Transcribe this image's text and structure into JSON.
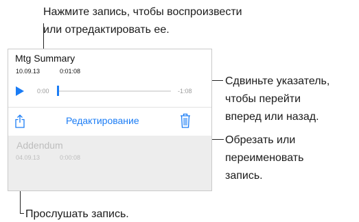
{
  "callouts": {
    "top_line1": "Нажмите запись, чтобы воспроизвести",
    "top_line2": "или отредактировать ее.",
    "scrub_line1": "Сдвиньте указатель,",
    "scrub_line2": "чтобы перейти",
    "scrub_line3": "вперед или назад.",
    "edit_line1": "Обрезать или",
    "edit_line2": "переименовать",
    "edit_line3": "запись.",
    "play": "Прослушать запись."
  },
  "recording": {
    "title": "Mtg Summary",
    "date": "10.09.13",
    "duration": "0:01:08",
    "time_elapsed": "0:00",
    "time_remaining": "-1:08",
    "progress": 0
  },
  "toolbar": {
    "edit_label": "Редактирование"
  },
  "other_recording": {
    "title": "Addendum",
    "date": "04.09.13",
    "duration": "0:00:08"
  },
  "colors": {
    "accent": "#1a7cf5",
    "dimmed_row": "#ededed",
    "dimmed_text": "#bdbdbd"
  },
  "icons": [
    "play-icon",
    "share-icon",
    "trash-icon"
  ]
}
